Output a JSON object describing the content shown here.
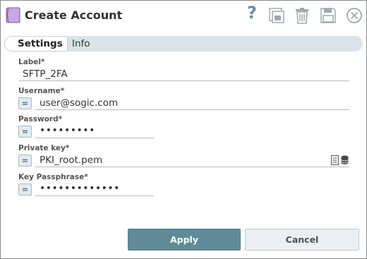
{
  "dialog": {
    "title": "Create Account",
    "header_icons": [
      "help-icon",
      "copy-icon",
      "trash-icon",
      "save-icon",
      "close-icon"
    ]
  },
  "help_label": "?",
  "tabs": [
    {
      "label": "Settings",
      "active": true
    },
    {
      "label": "Info",
      "active": false
    }
  ],
  "fields": {
    "label": {
      "label": "Label*",
      "value": "SFTP_2FA"
    },
    "username": {
      "label": "Username*",
      "value": "user@sogic.com",
      "expr_button": "="
    },
    "password": {
      "label": "Password*",
      "value": "•••••••••",
      "expr_button": "="
    },
    "private_key": {
      "label": "Private key*",
      "value": "PKI_root.pem",
      "expr_button": "=",
      "icons": [
        "file-browse-icon",
        "database-icon"
      ]
    },
    "key_passphrase": {
      "label": "Key Passphrase*",
      "value": "•••••••••••••",
      "expr_button": "="
    }
  },
  "buttons": {
    "apply": "Apply",
    "cancel": "Cancel"
  },
  "colors": {
    "accent": "#5f8a96",
    "tab_bar": "#dbe3e6",
    "icon_gray": "#a0a8ad",
    "help_blue": "#6a8fa6",
    "logo_purple": "#c9a6e8"
  }
}
